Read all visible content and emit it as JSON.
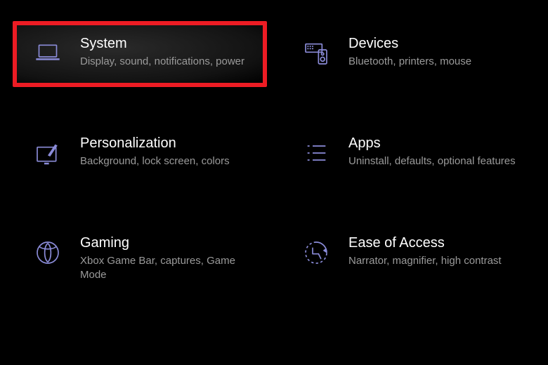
{
  "colors": {
    "accent": "#8b8cd9",
    "highlight_border": "#ed1c24",
    "bg": "#000000",
    "title": "#ffffff",
    "desc": "#9a9a9a"
  },
  "settings": {
    "items": [
      {
        "title": "System",
        "desc": "Display, sound, notifications, power",
        "icon": "laptop-icon",
        "highlighted": true
      },
      {
        "title": "Devices",
        "desc": "Bluetooth, printers, mouse",
        "icon": "devices-icon",
        "highlighted": false
      },
      {
        "title": "Personalization",
        "desc": "Background, lock screen, colors",
        "icon": "personalization-icon",
        "highlighted": false
      },
      {
        "title": "Apps",
        "desc": "Uninstall, defaults, optional features",
        "icon": "apps-icon",
        "highlighted": false
      },
      {
        "title": "Gaming",
        "desc": "Xbox Game Bar, captures, Game Mode",
        "icon": "gaming-icon",
        "highlighted": false
      },
      {
        "title": "Ease of Access",
        "desc": "Narrator, magnifier, high contrast",
        "icon": "ease-of-access-icon",
        "highlighted": false
      }
    ]
  }
}
